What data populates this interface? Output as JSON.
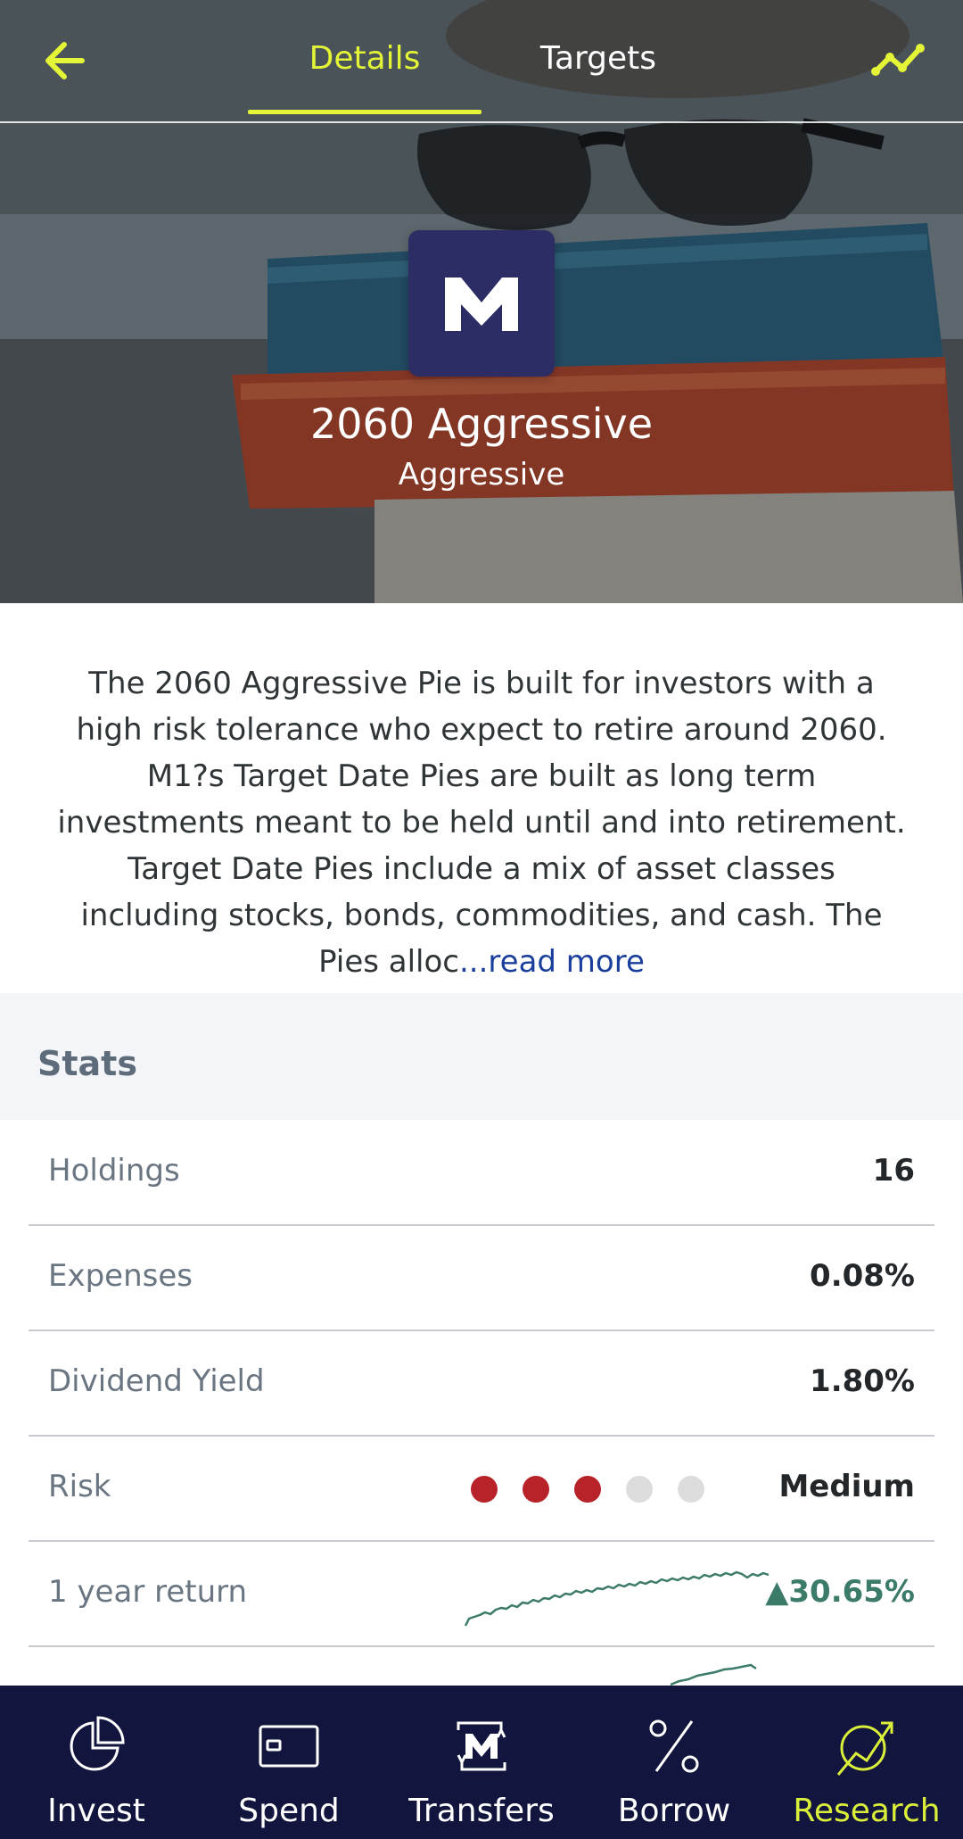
{
  "header": {
    "tabs": [
      {
        "label": "Details",
        "active": true
      },
      {
        "label": "Targets",
        "active": false
      }
    ],
    "accent_color": "#e3f536"
  },
  "pie": {
    "title": "2060 Aggressive",
    "subtitle": "Aggressive",
    "logo_text": "M"
  },
  "description": {
    "text": "The 2060 Aggressive Pie is built for investors with a high risk tolerance who expect to retire around 2060. M1?s Target Date Pies are built as long term investments meant to be held until and into retirement. Target Date Pies include a mix of asset classes including stocks, bonds, commodities, and cash. The Pies alloc",
    "read_more": "...read more"
  },
  "stats": {
    "title": "Stats",
    "rows": {
      "holdings": {
        "label": "Holdings",
        "value": "16"
      },
      "expenses": {
        "label": "Expenses",
        "value": "0.08%"
      },
      "dividend_yield": {
        "label": "Dividend Yield",
        "value": "1.80%"
      },
      "risk": {
        "label": "Risk",
        "value": "Medium",
        "level": 3,
        "max": 5
      },
      "one_year_return": {
        "label": "1 year return",
        "value": "▲30.65%"
      }
    }
  },
  "colors": {
    "risk_on": "#b8232a",
    "risk_off": "#dcdcdc",
    "positive": "#3c7a6a",
    "nav_bg": "#12153d",
    "nav_active": "#dbef3a",
    "logo_bg": "#2b2d64"
  },
  "bottom_nav": [
    {
      "label": "Invest",
      "icon": "pie-chart-icon",
      "active": false
    },
    {
      "label": "Spend",
      "icon": "card-icon",
      "active": false
    },
    {
      "label": "Transfers",
      "icon": "transfers-icon",
      "active": false
    },
    {
      "label": "Borrow",
      "icon": "percent-icon",
      "active": false
    },
    {
      "label": "Research",
      "icon": "research-icon",
      "active": true
    }
  ]
}
